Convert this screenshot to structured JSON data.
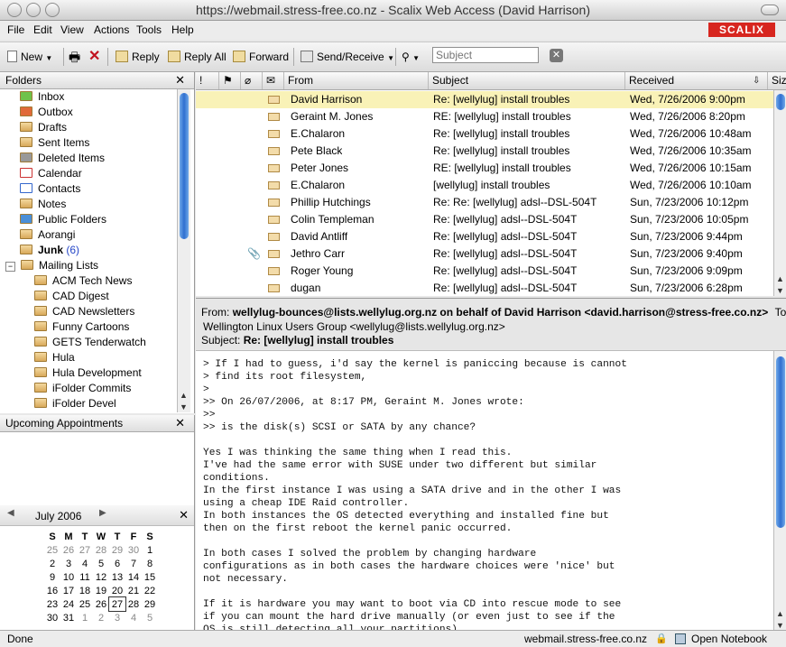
{
  "window": {
    "title": "https://webmail.stress-free.co.nz - Scalix Web Access (David Harrison)"
  },
  "brand": {
    "logo": "SCALIX",
    "color": "#d7261f"
  },
  "menu": [
    "File",
    "Edit",
    "View",
    "Actions",
    "Tools",
    "Help"
  ],
  "toolbar": {
    "new_label": "New",
    "reply_label": "Reply",
    "reply_all_label": "Reply All",
    "forward_label": "Forward",
    "send_receive_label": "Send/Receive",
    "search_placeholder": "Subject"
  },
  "folders": {
    "title": "Folders",
    "items": [
      {
        "label": "Inbox"
      },
      {
        "label": "Outbox"
      },
      {
        "label": "Drafts"
      },
      {
        "label": "Sent Items"
      },
      {
        "label": "Deleted Items"
      },
      {
        "label": "Calendar"
      },
      {
        "label": "Contacts"
      },
      {
        "label": "Notes"
      },
      {
        "label": "Public Folders"
      },
      {
        "label": "Aorangi"
      },
      {
        "label": "Junk",
        "count": "(6)"
      },
      {
        "label": "Mailing Lists"
      },
      {
        "label": "ACM Tech News"
      },
      {
        "label": "CAD Digest"
      },
      {
        "label": "CAD Newsletters"
      },
      {
        "label": "Funny Cartoons"
      },
      {
        "label": "GETS Tenderwatch"
      },
      {
        "label": "Hula"
      },
      {
        "label": "Hula Development"
      },
      {
        "label": "iFolder Commits"
      },
      {
        "label": "iFolder Devel"
      }
    ]
  },
  "appointments": {
    "title": "Upcoming Appointments"
  },
  "calendar": {
    "month": "July 2006",
    "weekdays": [
      "S",
      "M",
      "T",
      "W",
      "T",
      "F",
      "S"
    ],
    "weeks": [
      [
        "25",
        "26",
        "27",
        "28",
        "29",
        "30",
        "1"
      ],
      [
        "2",
        "3",
        "4",
        "5",
        "6",
        "7",
        "8"
      ],
      [
        "9",
        "10",
        "11",
        "12",
        "13",
        "14",
        "15"
      ],
      [
        "16",
        "17",
        "18",
        "19",
        "20",
        "21",
        "22"
      ],
      [
        "23",
        "24",
        "25",
        "26",
        "27",
        "28",
        "29"
      ],
      [
        "30",
        "31",
        "1",
        "2",
        "3",
        "4",
        "5"
      ]
    ],
    "today": "27"
  },
  "message_list": {
    "columns": {
      "from": "From",
      "subject": "Subject",
      "received": "Received",
      "size": "Size"
    },
    "rows": [
      {
        "from": "David Harrison",
        "subject": "Re: [wellylug] install troubles",
        "received": "Wed, 7/26/2006 9:00pm",
        "selected": true
      },
      {
        "from": "Geraint M. Jones",
        "subject": "RE: [wellylug] install troubles",
        "received": "Wed, 7/26/2006 8:20pm"
      },
      {
        "from": "E.Chalaron",
        "subject": "Re: [wellylug] install troubles",
        "received": "Wed, 7/26/2006 10:48am"
      },
      {
        "from": "Pete Black",
        "subject": "Re: [wellylug] install troubles",
        "received": "Wed, 7/26/2006 10:35am"
      },
      {
        "from": "Peter Jones",
        "subject": "RE: [wellylug] install troubles",
        "received": "Wed, 7/26/2006 10:15am"
      },
      {
        "from": "E.Chalaron",
        "subject": "[wellylug] install troubles",
        "received": "Wed, 7/26/2006 10:10am"
      },
      {
        "from": "Phillip Hutchings",
        "subject": "Re: Re: [wellylug] adsl--DSL-504T",
        "received": "Sun, 7/23/2006 10:12pm"
      },
      {
        "from": "Colin Templeman",
        "subject": "Re: [wellylug] adsl--DSL-504T",
        "received": "Sun, 7/23/2006 10:05pm"
      },
      {
        "from": "David Antliff",
        "subject": "Re: [wellylug] adsl--DSL-504T",
        "received": "Sun, 7/23/2006 9:44pm"
      },
      {
        "from": "Jethro Carr",
        "subject": "Re: [wellylug] adsl--DSL-504T",
        "received": "Sun, 7/23/2006 9:40pm",
        "attachment": true
      },
      {
        "from": "Roger Young",
        "subject": "Re: [wellylug] adsl--DSL-504T",
        "received": "Sun, 7/23/2006 9:09pm"
      },
      {
        "from": "dugan",
        "subject": "Re: [wellylug] adsl--DSL-504T",
        "received": "Sun, 7/23/2006 6:28pm"
      }
    ]
  },
  "preview": {
    "from_label": "From:",
    "from_value": "wellylug-bounces@lists.wellylug.org.nz on behalf of David Harrison <david.harrison@stress-free.co.nz>",
    "to_label": "To:",
    "to_value": "Wellington Linux Users Group <wellylug@lists.wellylug.org.nz>",
    "subject_label": "Subject:",
    "subject_value": "Re: [wellylug] install troubles",
    "body": "> If I had to guess, i'd say the kernel is paniccing because is cannot\n> find its root filesystem,\n>\n>> On 26/07/2006, at 8:17 PM, Geraint M. Jones wrote:\n>>\n>> is the disk(s) SCSI or SATA by any chance?\n\nYes I was thinking the same thing when I read this.\nI've had the same error with SUSE under two different but similar\nconditions.\nIn the first instance I was using a SATA drive and in the other I was\nusing a cheap IDE Raid controller.\nIn both instances the OS detected everything and installed fine but\nthen on the first reboot the kernel panic occurred.\n\nIn both cases I solved the problem by changing hardware\nconfigurations as in both cases the hardware choices were 'nice' but\nnot necessary.\n\nIf it is hardware you may want to boot via CD into rescue mode to see\nif you can mount the hard drive manually (or even just to see if the\nOS is still detecting all your partitions)"
  },
  "status": {
    "left": "Done",
    "host": "webmail.stress-free.co.nz",
    "notebook": "Open Notebook"
  }
}
